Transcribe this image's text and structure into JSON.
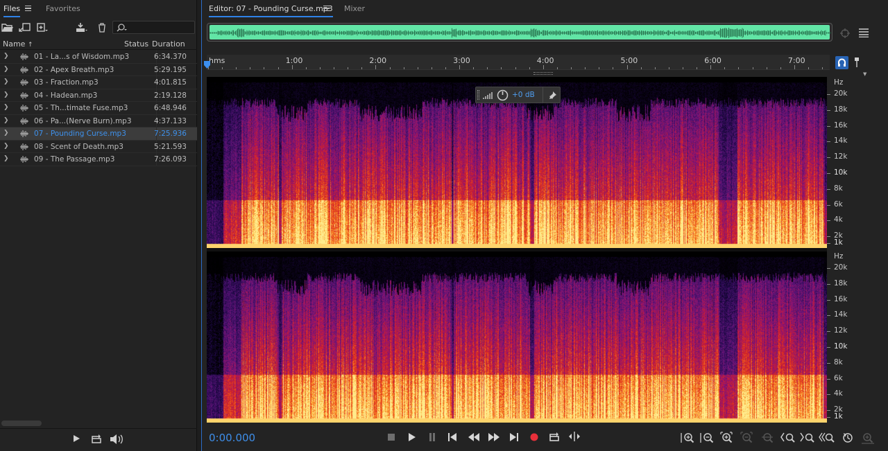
{
  "files_panel": {
    "tabs": {
      "files": "Files",
      "favorites": "Favorites"
    },
    "search": {
      "placeholder": ""
    },
    "columns": {
      "name": "Name",
      "status": "Status",
      "duration": "Duration"
    },
    "files": [
      {
        "name": "01 - La...s of Wisdom.mp3",
        "duration": "6:34.370"
      },
      {
        "name": "02 - Apex Breath.mp3",
        "duration": "5:29.195"
      },
      {
        "name": "03 - Fraction.mp3",
        "duration": "4:01.815"
      },
      {
        "name": "04 - Hadean.mp3",
        "duration": "2:19.128"
      },
      {
        "name": "05 - Th...timate Fuse.mp3",
        "duration": "6:48.946"
      },
      {
        "name": "06 - Pa...(Nerve Burn).mp3",
        "duration": "4:37.133"
      },
      {
        "name": "07 - Pounding Curse.mp3",
        "duration": "7:25.936"
      },
      {
        "name": "08 - Scent of Death.mp3",
        "duration": "5:21.593"
      },
      {
        "name": "09 - The Passage.mp3",
        "duration": "7:26.093"
      }
    ],
    "selected_index": 6
  },
  "editor": {
    "tabs": {
      "editor": "Editor: 07 - Pounding Curse.mp3",
      "mixer": "Mixer"
    },
    "ruler": {
      "start": "hms",
      "labels": [
        "1:00",
        "2:00",
        "3:00",
        "4:00",
        "5:00",
        "6:00",
        "7:00"
      ]
    },
    "freq_axis": {
      "unit": "Hz",
      "labels": [
        "20k",
        "18k",
        "16k",
        "14k",
        "12k",
        "10k",
        "8k",
        "6k",
        "4k",
        "2k",
        "1k"
      ]
    },
    "hud": {
      "gain": "+0 dB"
    },
    "timecode": "0:00.000"
  },
  "colors": {
    "accent": "#2f82e8",
    "waveform": "#62e5a6",
    "selection_text": "#3e91ec",
    "record": "#e8303a"
  }
}
